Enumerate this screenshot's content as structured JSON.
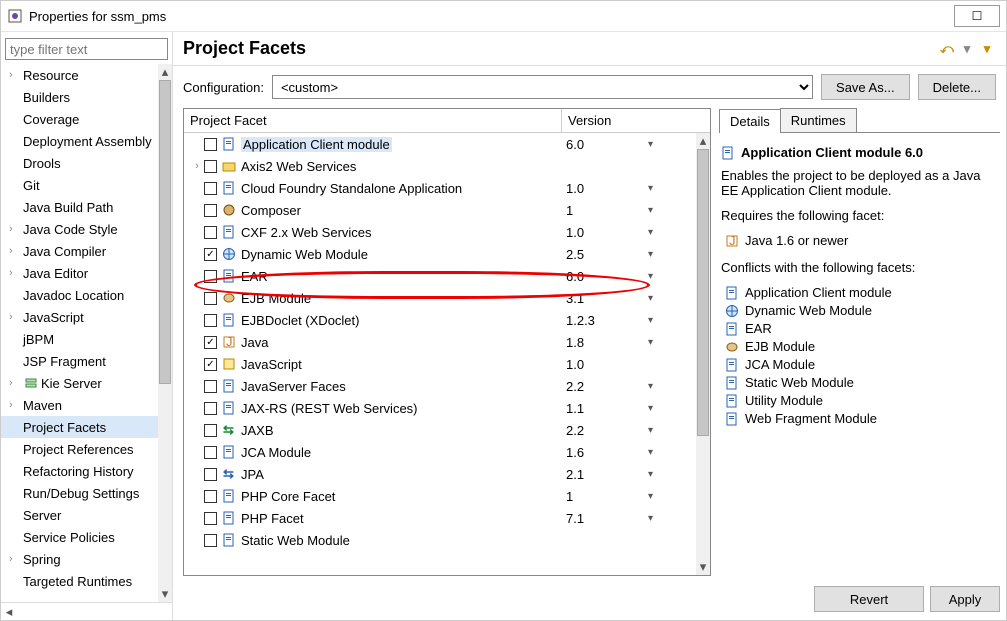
{
  "window_title": "Properties for ssm_pms",
  "filter_placeholder": "type filter text",
  "nav": [
    {
      "label": "Resource",
      "expandable": true
    },
    {
      "label": "Builders"
    },
    {
      "label": "Coverage"
    },
    {
      "label": "Deployment Assembly"
    },
    {
      "label": "Drools"
    },
    {
      "label": "Git"
    },
    {
      "label": "Java Build Path"
    },
    {
      "label": "Java Code Style",
      "expandable": true
    },
    {
      "label": "Java Compiler",
      "expandable": true
    },
    {
      "label": "Java Editor",
      "expandable": true
    },
    {
      "label": "Javadoc Location"
    },
    {
      "label": "JavaScript",
      "expandable": true
    },
    {
      "label": "jBPM"
    },
    {
      "label": "JSP Fragment"
    },
    {
      "label": "Kie Server",
      "expandable": true,
      "icon": "server"
    },
    {
      "label": "Maven",
      "expandable": true
    },
    {
      "label": "Project Facets",
      "selected": true
    },
    {
      "label": "Project References"
    },
    {
      "label": "Refactoring History"
    },
    {
      "label": "Run/Debug Settings"
    },
    {
      "label": "Server"
    },
    {
      "label": "Service Policies"
    },
    {
      "label": "Spring",
      "expandable": true
    },
    {
      "label": "Targeted Runtimes"
    }
  ],
  "page_title": "Project Facets",
  "config_label": "Configuration:",
  "config_value": "<custom>",
  "save_as_label": "Save As...",
  "delete_label": "Delete...",
  "facet_col1": "Project Facet",
  "facet_col2": "Version",
  "facets": [
    {
      "label": "Application Client module",
      "version": "6.0",
      "dd": true,
      "icon": "doc",
      "selected": true
    },
    {
      "label": "Axis2 Web Services",
      "version": "",
      "icon": "folder",
      "expandable": true
    },
    {
      "label": "Cloud Foundry Standalone Application",
      "version": "1.0",
      "dd": true,
      "icon": "doc"
    },
    {
      "label": "Composer",
      "version": "1",
      "dd": true,
      "icon": "composer"
    },
    {
      "label": "CXF 2.x Web Services",
      "version": "1.0",
      "dd": true,
      "icon": "doc"
    },
    {
      "label": "Dynamic Web Module",
      "version": "2.5",
      "dd": true,
      "icon": "globe",
      "checked": true,
      "highlight": true
    },
    {
      "label": "EAR",
      "version": "6.0",
      "dd": true,
      "icon": "doc"
    },
    {
      "label": "EJB Module",
      "version": "3.1",
      "dd": true,
      "icon": "bean"
    },
    {
      "label": "EJBDoclet (XDoclet)",
      "version": "1.2.3",
      "dd": true,
      "icon": "doc"
    },
    {
      "label": "Java",
      "version": "1.8",
      "dd": true,
      "icon": "java",
      "checked": true
    },
    {
      "label": "JavaScript",
      "version": "1.0",
      "icon": "js",
      "checked": true
    },
    {
      "label": "JavaServer Faces",
      "version": "2.2",
      "dd": true,
      "icon": "doc"
    },
    {
      "label": "JAX-RS (REST Web Services)",
      "version": "1.1",
      "dd": true,
      "icon": "doc"
    },
    {
      "label": "JAXB",
      "version": "2.2",
      "dd": true,
      "icon": "jaxb"
    },
    {
      "label": "JCA Module",
      "version": "1.6",
      "dd": true,
      "icon": "doc"
    },
    {
      "label": "JPA",
      "version": "2.1",
      "dd": true,
      "icon": "jpa"
    },
    {
      "label": "PHP Core Facet",
      "version": "1",
      "dd": true,
      "icon": "doc"
    },
    {
      "label": "PHP Facet",
      "version": "7.1",
      "dd": true,
      "icon": "doc"
    },
    {
      "label": "Static Web Module",
      "version": "",
      "icon": "doc"
    }
  ],
  "tabs": {
    "details": "Details",
    "runtimes": "Runtimes"
  },
  "details": {
    "title": "Application Client module 6.0",
    "desc": "Enables the project to be deployed as a Java EE Application Client module.",
    "req_label": "Requires the following facet:",
    "requires": [
      {
        "icon": "java",
        "label": "Java 1.6 or newer"
      }
    ],
    "conf_label": "Conflicts with the following facets:",
    "conflicts": [
      {
        "icon": "doc",
        "label": "Application Client module"
      },
      {
        "icon": "globe",
        "label": "Dynamic Web Module"
      },
      {
        "icon": "doc",
        "label": "EAR"
      },
      {
        "icon": "bean",
        "label": "EJB Module"
      },
      {
        "icon": "doc",
        "label": "JCA Module"
      },
      {
        "icon": "doc",
        "label": "Static Web Module"
      },
      {
        "icon": "doc",
        "label": "Utility Module"
      },
      {
        "icon": "doc",
        "label": "Web Fragment Module"
      }
    ]
  },
  "revert_label": "Revert",
  "apply_label": "Apply"
}
